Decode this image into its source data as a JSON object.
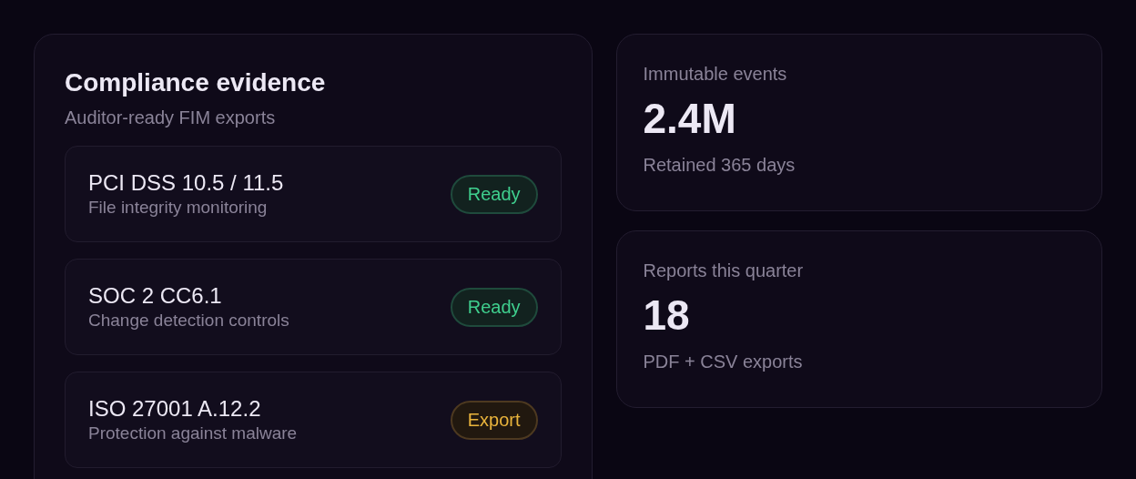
{
  "evidence": {
    "title": "Compliance evidence",
    "subtitle": "Auditor-ready FIM exports",
    "items": [
      {
        "name": "PCI DSS 10.5 / 11.5",
        "description": "File integrity monitoring",
        "badge": "Ready",
        "kind": "ready"
      },
      {
        "name": "SOC 2 CC6.1",
        "description": "Change detection controls",
        "badge": "Ready",
        "kind": "ready"
      },
      {
        "name": "ISO 27001 A.12.2",
        "description": "Protection against malware",
        "badge": "Export",
        "kind": "export"
      }
    ]
  },
  "stats": [
    {
      "label": "Immutable events",
      "value": "2.4M",
      "note": "Retained 365 days"
    },
    {
      "label": "Reports this quarter",
      "value": "18",
      "note": "PDF + CSV exports"
    }
  ]
}
